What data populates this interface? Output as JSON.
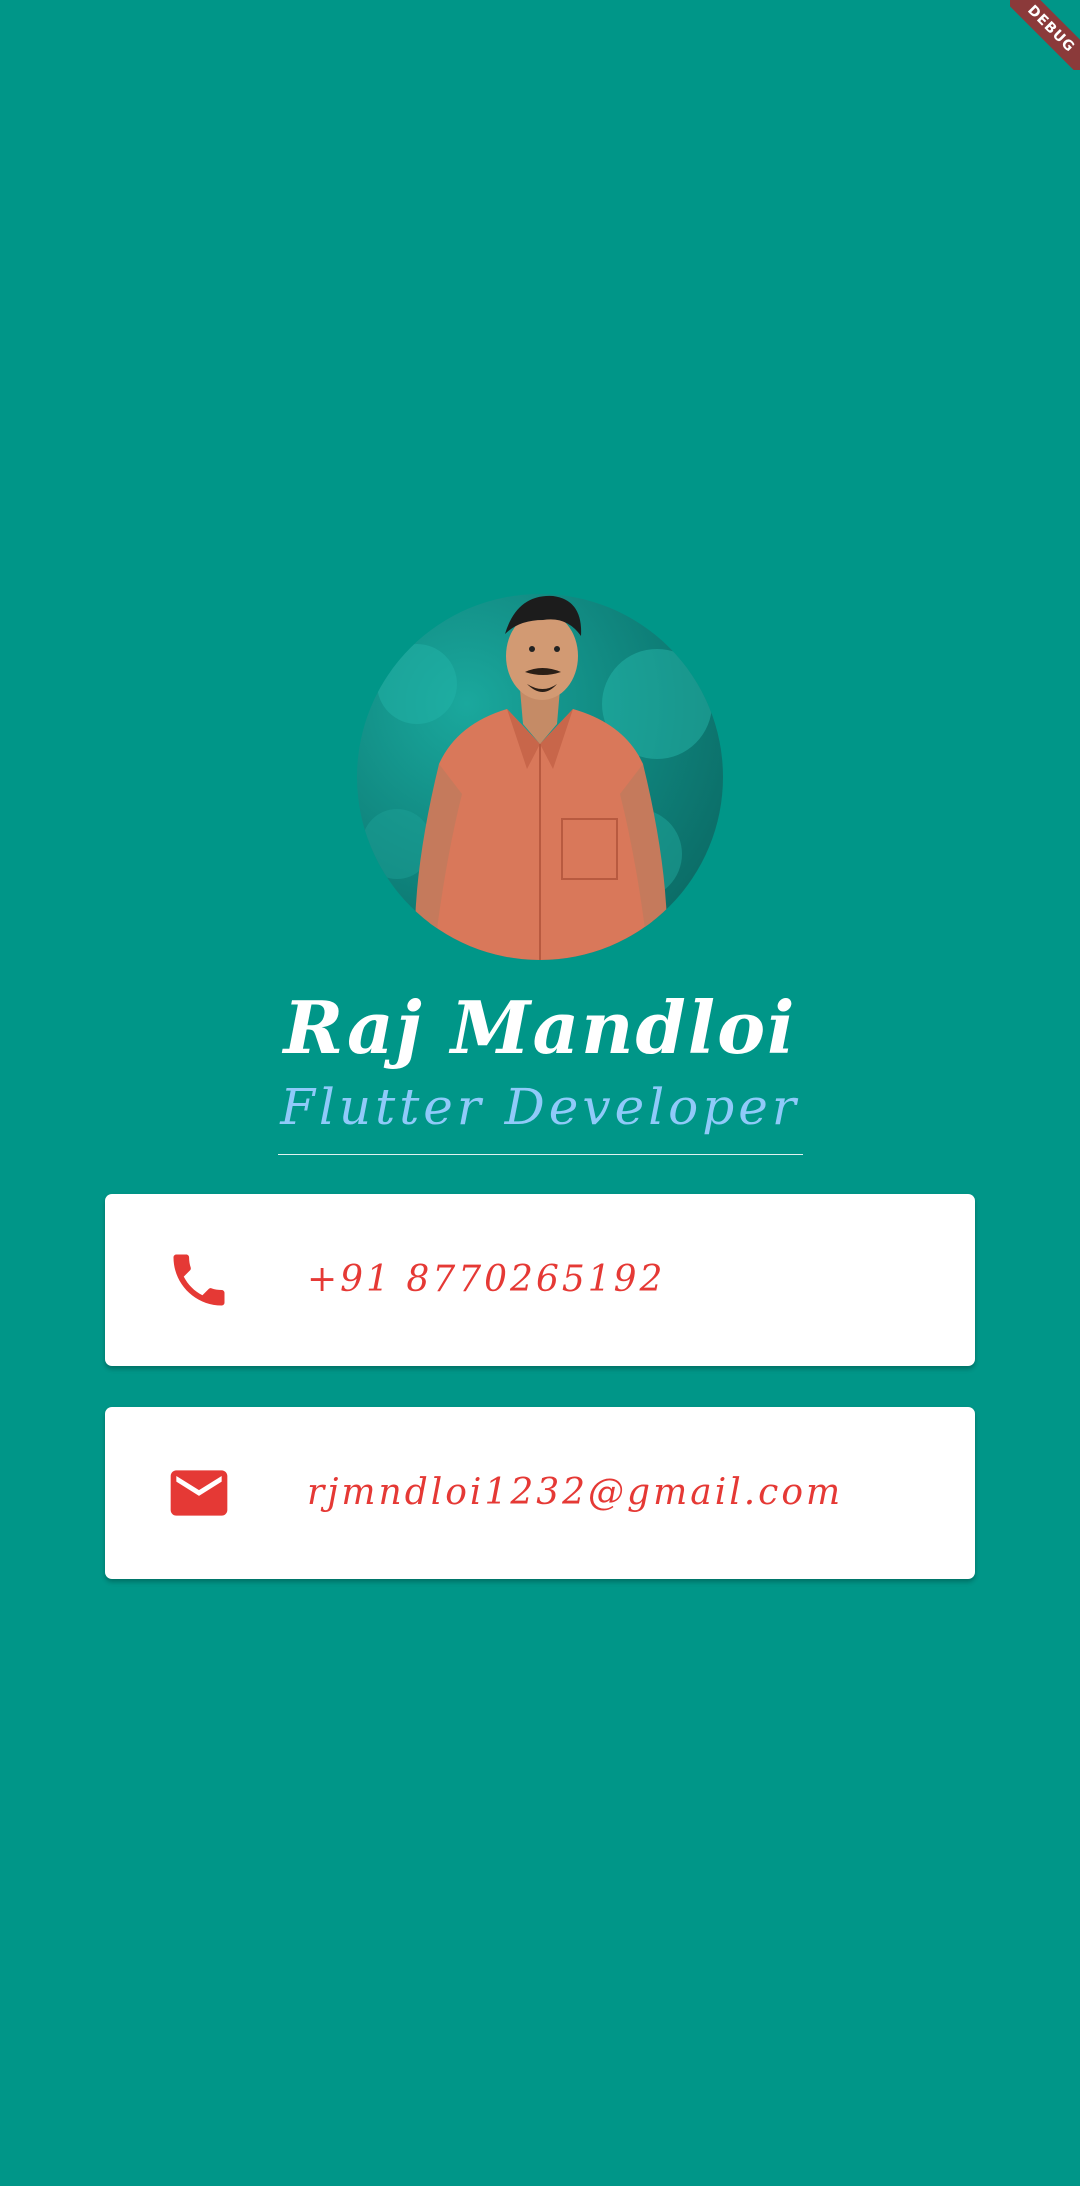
{
  "debug_banner": {
    "label": "DEBUG"
  },
  "profile": {
    "name": "Raj Mandloi",
    "title": "Flutter Developer",
    "avatar_icon": "profile-photo"
  },
  "contacts": {
    "phone": {
      "icon": "phone-icon",
      "value": "+91 8770265192"
    },
    "email": {
      "icon": "mail-icon",
      "value": "rjmndloi1232@gmail.com"
    }
  },
  "colors": {
    "background": "#009688",
    "name_text": "#ffffff",
    "title_text": "#90caf9",
    "card_background": "#ffffff",
    "accent": "#e53935"
  }
}
